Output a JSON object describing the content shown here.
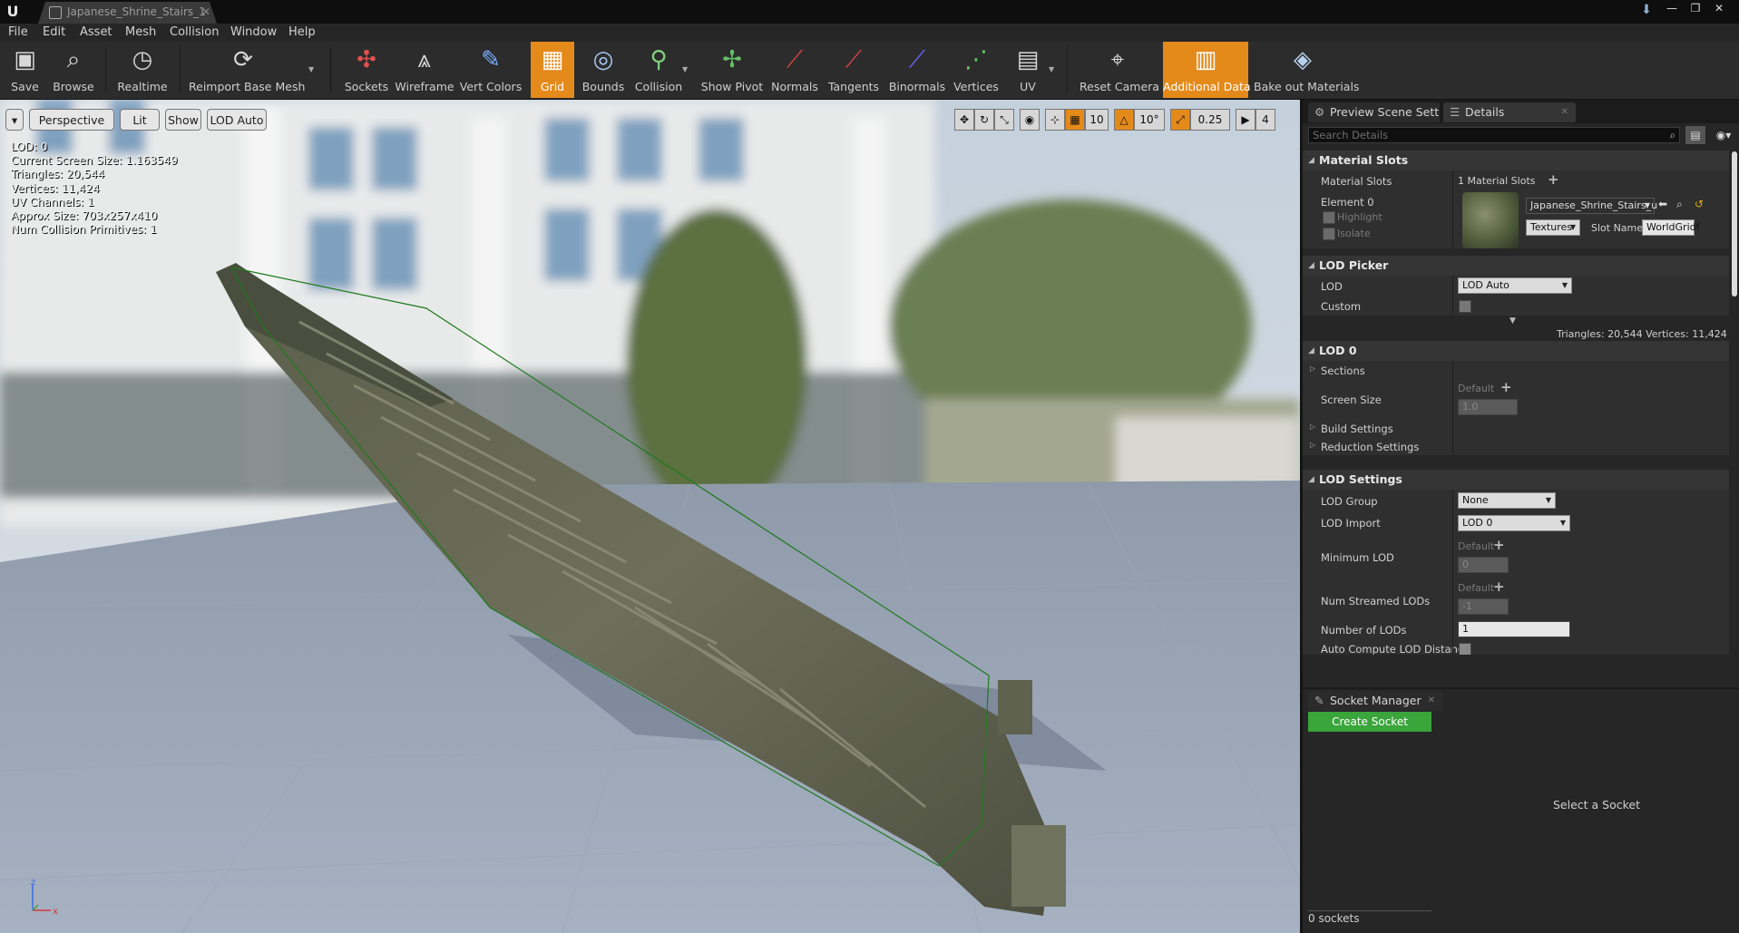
{
  "window": {
    "tab_title": "Japanese_Shrine_Stairs_1",
    "logo": "U",
    "controls": [
      "—",
      "❐",
      "✕"
    ]
  },
  "menu": [
    "File",
    "Edit",
    "Asset",
    "Mesh",
    "Collision",
    "Window",
    "Help"
  ],
  "toolbar": [
    {
      "label": "Save",
      "icon": "save-icon"
    },
    {
      "label": "Browse",
      "icon": "browse-icon"
    },
    {
      "label": "Realtime",
      "icon": "realtime-icon"
    },
    {
      "label": "Reimport Base Mesh",
      "icon": "reimport-icon"
    },
    {
      "label": "Sockets",
      "icon": "sockets-icon"
    },
    {
      "label": "Wireframe",
      "icon": "wireframe-icon"
    },
    {
      "label": "Vert Colors",
      "icon": "vert-colors-icon"
    },
    {
      "label": "Grid",
      "icon": "grid-icon",
      "active": true
    },
    {
      "label": "Bounds",
      "icon": "bounds-icon"
    },
    {
      "label": "Collision",
      "icon": "collision-icon"
    },
    {
      "label": "Show Pivot",
      "icon": "pivot-icon"
    },
    {
      "label": "Normals",
      "icon": "normals-icon"
    },
    {
      "label": "Tangents",
      "icon": "tangents-icon"
    },
    {
      "label": "Binormals",
      "icon": "binormals-icon"
    },
    {
      "label": "Vertices",
      "icon": "vertices-icon"
    },
    {
      "label": "UV",
      "icon": "uv-icon"
    },
    {
      "label": "Reset Camera",
      "icon": "reset-camera-icon"
    },
    {
      "label": "Additional Data",
      "icon": "additional-data-icon",
      "active": true
    },
    {
      "label": "Bake out Materials",
      "icon": "bake-materials-icon"
    }
  ],
  "viewport": {
    "view_mode": "Perspective",
    "lit": "Lit",
    "show": "Show",
    "lod": "LOD Auto",
    "grid_snap": "10",
    "rot_snap": "10°",
    "scale_snap": "0.25",
    "cam_speed": "4",
    "stats": [
      "LOD:  0",
      "Current Screen Size:  1.163549",
      "Triangles:  20,544",
      "Vertices:  11,424",
      "UV Channels:  1",
      "Approx Size: 703x257x410",
      "Num Collision Primitives:  1"
    ],
    "axis_x": "x",
    "axis_z": "z"
  },
  "panel_tabs": {
    "preview": "Preview Scene Sett",
    "details": "Details"
  },
  "details": {
    "search_placeholder": "Search Details",
    "material_slots": {
      "header": "Material Slots",
      "label": "Material Slots",
      "count": "1 Material Slots",
      "element": "Element 0",
      "highlight": "Highlight",
      "isolate": "Isolate",
      "material": "Japanese_Shrine_Stairs_u",
      "textures": "Textures",
      "slot_name_label": "Slot Name",
      "slot_name": "WorldGridf"
    },
    "lod_picker": {
      "header": "LOD Picker",
      "lod_label": "LOD",
      "lod_value": "LOD Auto",
      "custom_label": "Custom"
    },
    "lod_info": "Triangles: 20,544   Vertices: 11,424",
    "lod0": {
      "header": "LOD 0",
      "sections": "Sections",
      "screen_size": "Screen Size",
      "default": "Default",
      "screen_size_value": "1.0",
      "build_settings": "Build Settings",
      "reduction_settings": "Reduction Settings"
    },
    "lod_settings": {
      "header": "LOD Settings",
      "lod_group": "LOD Group",
      "lod_group_value": "None",
      "lod_import": "LOD Import",
      "lod_import_value": "LOD 0",
      "minimum_lod": "Minimum LOD",
      "default": "Default",
      "minimum_lod_value": "0",
      "num_streamed": "Num Streamed LODs",
      "num_streamed_value": "-1",
      "number_of_lods": "Number of LODs",
      "number_of_lods_value": "1",
      "auto_compute": "Auto Compute LOD Distance"
    }
  },
  "socket_manager": {
    "title": "Socket Manager",
    "create": "Create Socket",
    "select": "Select a Socket",
    "count": "0 sockets"
  }
}
